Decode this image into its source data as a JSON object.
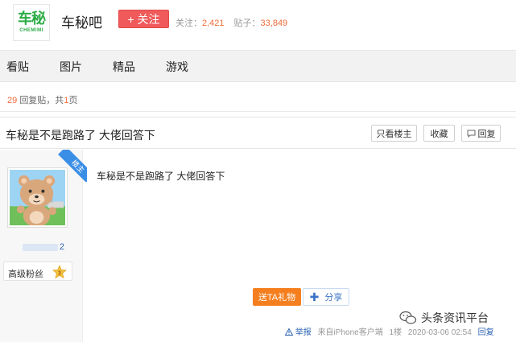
{
  "header": {
    "logo_main": "车秘",
    "logo_sub": "CHEMIMI",
    "forum_name": "车秘吧",
    "follow_label": "+ 关注",
    "followers_label": "关注：",
    "followers_count": "2,421",
    "posts_label": "贴子：",
    "posts_count": "33,849"
  },
  "nav": {
    "items": [
      "看贴",
      "图片",
      "精品",
      "游戏"
    ]
  },
  "reply_info": {
    "count": "29",
    "suffix": "回复贴，共",
    "pages": "1",
    "page_unit": "页"
  },
  "thread": {
    "title": "车秘是不是跑路了 大佬回答下",
    "only_op_label": "只看楼主",
    "favorite_label": "收藏",
    "reply_label": "回复"
  },
  "post": {
    "corner_label": "楼主",
    "username_suffix": "2",
    "fan_level_label": "高级粉丝",
    "fan_level": "3",
    "content": "车秘是不是跑路了 大佬回答下",
    "gift_label": "送TA礼物",
    "share_label": "分享",
    "report_label": "举报",
    "source": "来自iPhone客户端",
    "floor": "1楼",
    "time": "2020-03-06 02:54",
    "reply_link": "回复"
  },
  "watermark": {
    "text": "头条资讯平台"
  },
  "colors": {
    "brand_green": "#2bab44",
    "follow_red": "#f05a5a",
    "accent_orange": "#f26b3a",
    "link_blue": "#2d64b3",
    "gift_orange": "#f57f1f"
  }
}
